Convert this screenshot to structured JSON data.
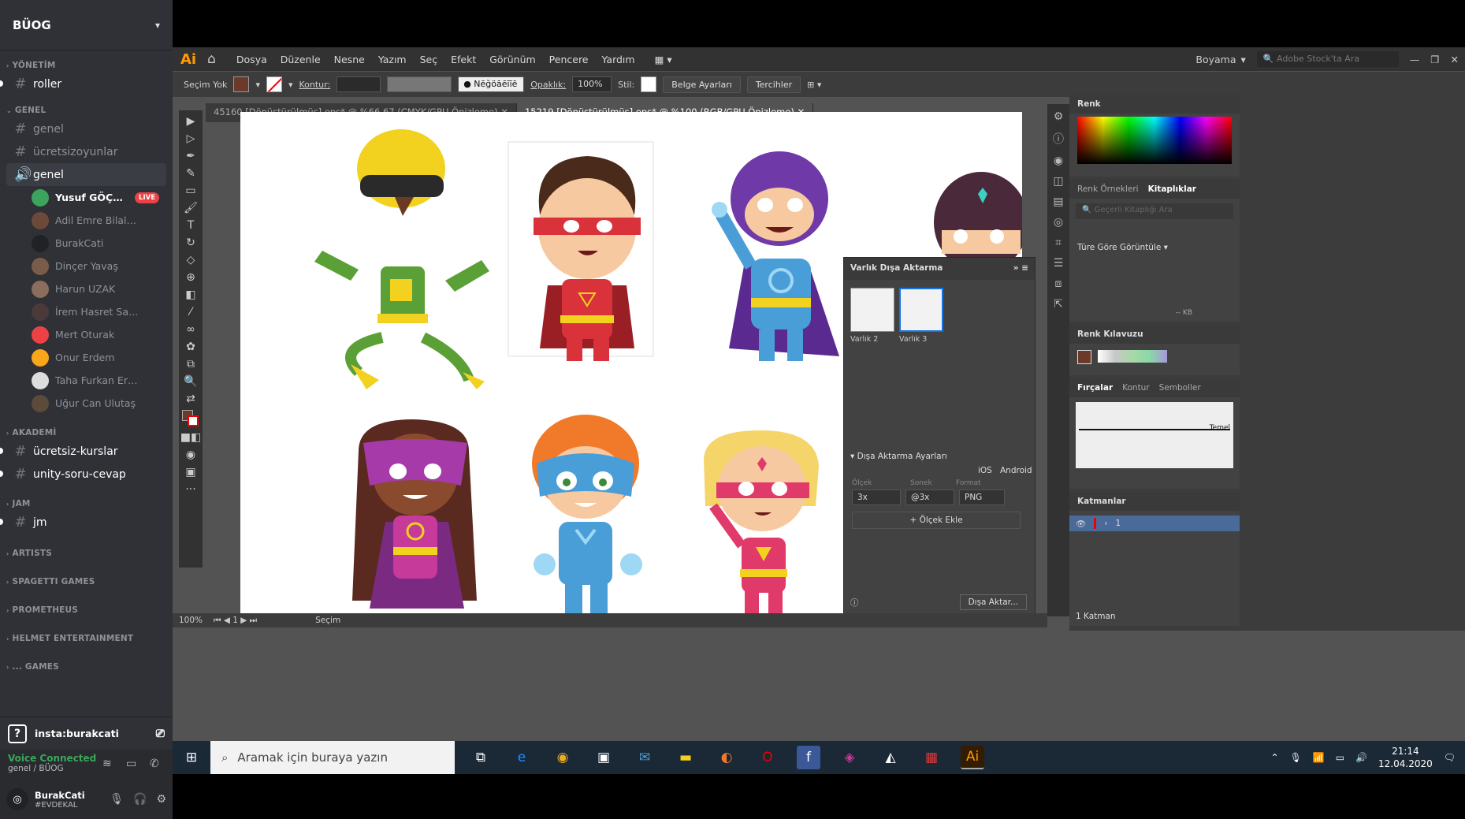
{
  "discord": {
    "server_name": "BÜOG",
    "categories": {
      "yonetim": "YÖNETİM",
      "genel": "GENEL",
      "akademi": "AKADEMİ",
      "jam": "JAM",
      "artists": "ARTISTS",
      "spaghetti": "SPAGETTI GAMES",
      "prometheus": "PROMETHEUS",
      "helmet": "HELMET ENTERTAINMENT",
      "games": "... GAMES"
    },
    "channels": {
      "roller": "roller",
      "genel_text": "genel",
      "ucretsizoyunlar": "ücretsizoyunlar",
      "genel_voice": "genel",
      "ucretsiz_kurslar": "ücretsiz-kurslar",
      "unity_soru_cevap": "unity-soru-cevap",
      "jm": "jm"
    },
    "voice_users": [
      {
        "name": "Yusuf GÖÇMEN",
        "live": "LIVE",
        "color": "#3ba55d"
      },
      {
        "name": "Adil Emre Bilaloğlu",
        "color": "#6b4a3a"
      },
      {
        "name": "BurakCati",
        "color": "#202225"
      },
      {
        "name": "Dinçer Yavaş",
        "color": "#7a5c4a"
      },
      {
        "name": "Harun UZAK",
        "color": "#8a6d5c"
      },
      {
        "name": "İrem Hasret Sancak...",
        "color": "#4a3a3a"
      },
      {
        "name": "Mert Oturak",
        "color": "#ed4245"
      },
      {
        "name": "Onur Erdem",
        "color": "#faa61a"
      },
      {
        "name": "Taha Furkan Ertürk",
        "color": "#ddd"
      },
      {
        "name": "Uğur Can Ulutaş",
        "color": "#5c4a3a"
      }
    ],
    "insta_label": "insta:burakcati",
    "voice_status": "Voice Connected",
    "voice_channel": "genel / BÜOG",
    "user_name": "BurakCati",
    "user_tag": "#EVDEKAL"
  },
  "illustrator": {
    "logo": "Ai",
    "menu": [
      "Dosya",
      "Düzenle",
      "Nesne",
      "Yazım",
      "Seç",
      "Efekt",
      "Görünüm",
      "Pencere",
      "Yardım"
    ],
    "workspace": "Boyama",
    "stock_placeholder": "Adobe Stock'ta Ara",
    "control": {
      "selection": "Seçim Yok",
      "stroke_label": "Kontur:",
      "brush_label": "Nēğöāēīīē",
      "opacity_label": "Opaklık:",
      "opacity_value": "100%",
      "style_label": "Stil:",
      "doc_settings": "Belge Ayarları",
      "preferences": "Tercihler"
    },
    "tabs": [
      "45160 [Dönüştürülmüş].eps* @ %66,67 (CMYK/GPU Önizleme)",
      "15219 [Dönüştürülmüş].eps* @ %100 (RGB/GPU Önizleme)"
    ],
    "status": {
      "zoom": "100%",
      "page": "1",
      "mode": "Seçim"
    },
    "export_panel": {
      "title": "Varlık Dışa Aktarma",
      "assets": [
        "Varlık 2",
        "Varlık 3"
      ],
      "settings_title": "Dışa Aktarma Ayarları",
      "ios": "iOS",
      "android": "Android",
      "scale_label": "Ölçek",
      "suffix_label": "Sonek",
      "format_label": "Format",
      "scale": "3x",
      "suffix": "@3x",
      "format": "PNG",
      "add_scale": "+ Ölçek Ekle",
      "export_button": "Dışa Aktar..."
    },
    "right_panels": {
      "color_title": "Renk",
      "swatches_tab": "Renk Örnekleri",
      "libraries_tab": "Kitaplıklar",
      "search_placeholder": "Geçerli Kitaplığı Ara",
      "view_by": "Türe Göre Görüntüle",
      "kb": "-- KB",
      "color_guide": "Renk Kılavuzu",
      "brushes_tab": "Fırçalar",
      "stroke_tab": "Kontur",
      "symbols_tab": "Semboller",
      "brush_basic": "Temel",
      "layers_title": "Katmanlar",
      "layer_name": "1",
      "layer_count": "1 Katman"
    }
  },
  "taskbar": {
    "search_placeholder": "Aramak için buraya yazın",
    "time": "21:14",
    "date": "12.04.2020"
  }
}
